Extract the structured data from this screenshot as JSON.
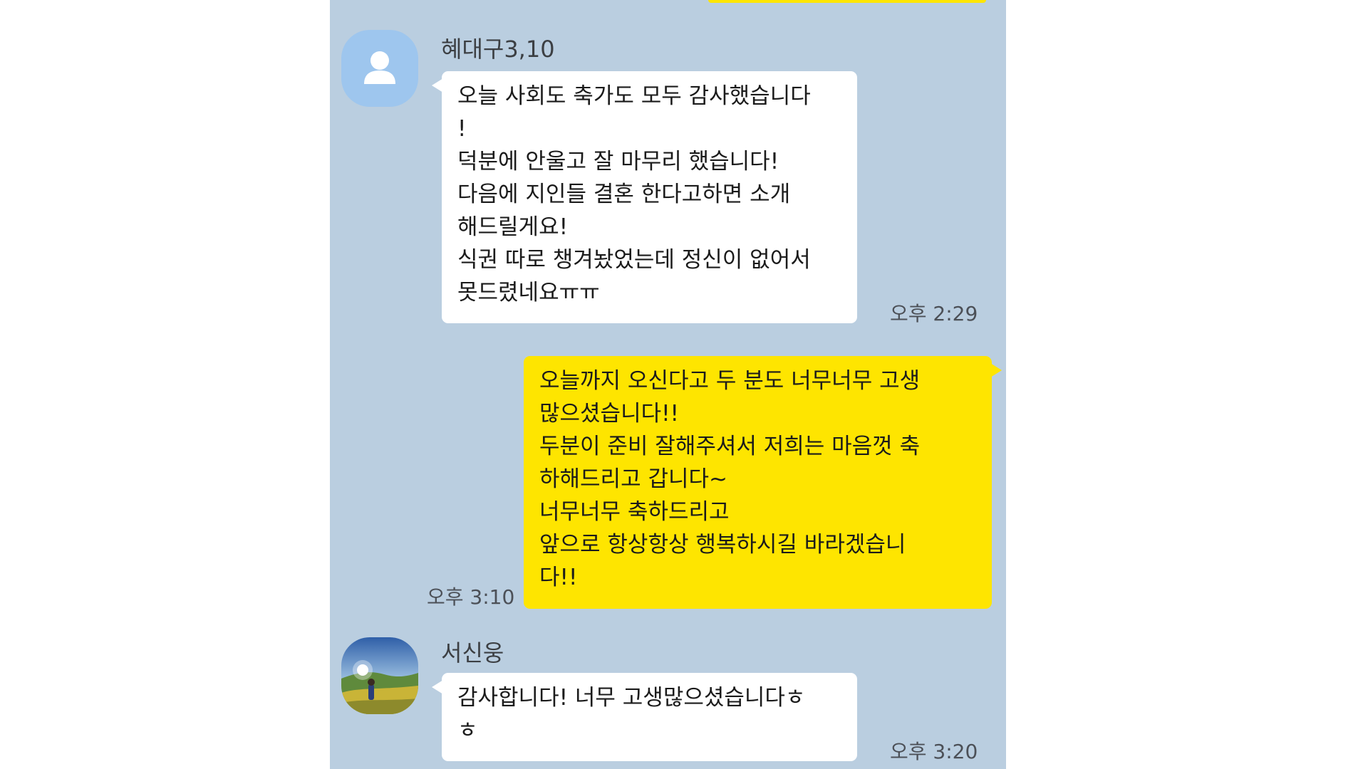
{
  "colors": {
    "chat_background": "#bacee0",
    "incoming_bubble": "#ffffff",
    "outgoing_bubble": "#fee500",
    "text": "#1b1b1b"
  },
  "messages": [
    {
      "sender": "혜대구3,10",
      "avatar": "default-person-icon",
      "lines": [
        "오늘 사회도 축가도 모두 감사했습니다",
        "!",
        "덕분에 안울고 잘 마무리 했습니다!",
        "다음에 지인들 결혼 한다고하면 소개",
        "해드릴게요!",
        "식권 따로 챙겨놨었는데 정신이 없어서",
        " 못드렸네요ㅠㅠ"
      ],
      "time": "오후 2:29"
    },
    {
      "lines": [
        "오늘까지 오신다고 두 분도 너무너무 고생",
        "많으셨습니다!!",
        "두분이 준비 잘해주셔서 저희는 마음껏 축",
        "하해드리고 갑니다~",
        "너무너무 축하드리고",
        "앞으로 항상항상 행복하시길 바라겠습니",
        "다!!"
      ],
      "time": "오후 3:10"
    },
    {
      "sender": "서신웅",
      "avatar": "profile-photo",
      "lines": [
        "감사합니다! 너무 고생많으셨습니다ㅎ",
        "ㅎ"
      ],
      "time": "오후 3:20"
    }
  ]
}
